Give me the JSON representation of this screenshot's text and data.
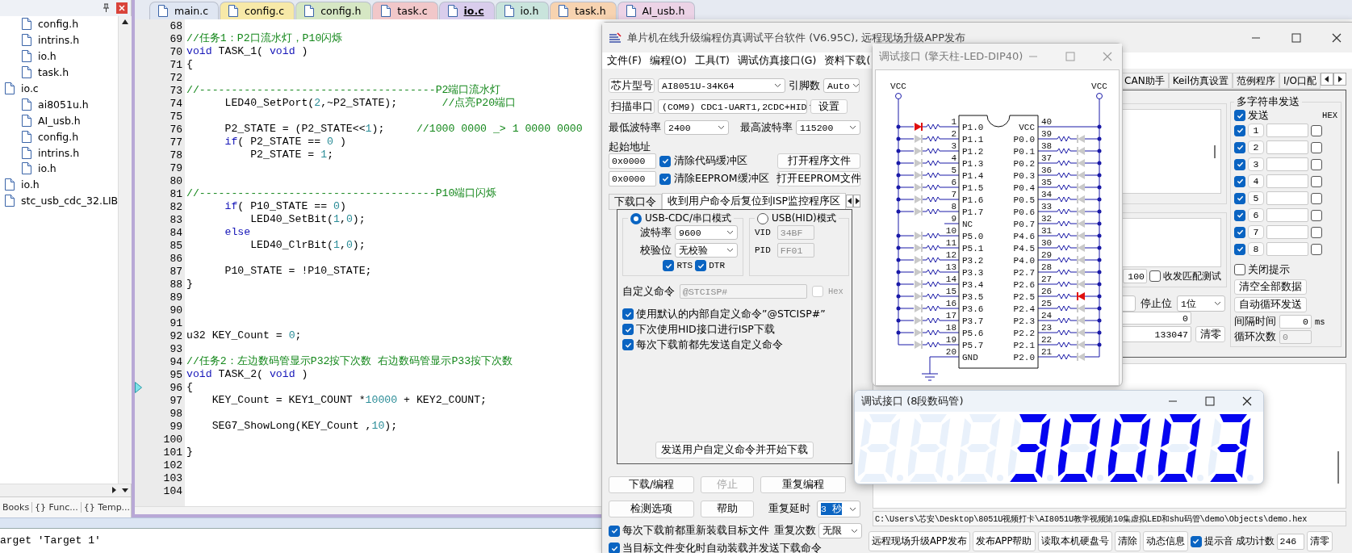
{
  "ide": {
    "project_panel": {
      "tree": [
        {
          "children": [
            {
              "label": "config.h"
            },
            {
              "label": "intrins.h"
            },
            {
              "label": "io.h"
            },
            {
              "label": "task.h"
            }
          ]
        },
        {
          "label": "io.c",
          "children": [
            {
              "label": "ai8051u.h"
            },
            {
              "label": "AI_usb.h"
            },
            {
              "label": "config.h"
            },
            {
              "label": "intrins.h"
            },
            {
              "label": "io.h"
            }
          ]
        },
        {
          "label": "io.h"
        },
        {
          "label": "stc_usb_cdc_32.LIB"
        }
      ],
      "bottom_tabs": [
        {
          "label": "Books"
        },
        {
          "label": "{} Func..."
        },
        {
          "label": "{} Temp..."
        }
      ]
    },
    "editor": {
      "tabs": [
        {
          "label": "main.c",
          "selected": false,
          "color": "#dfe6f2"
        },
        {
          "label": "config.c",
          "selected": false,
          "color": "#f7e9a8"
        },
        {
          "label": "config.h",
          "selected": false,
          "color": "#d6e7c4"
        },
        {
          "label": "task.c",
          "selected": false,
          "color": "#f1c7c9"
        },
        {
          "label": "io.c",
          "selected": true,
          "color": "#d9cdec"
        },
        {
          "label": "io.h",
          "selected": false,
          "color": "#c9e4dc"
        },
        {
          "label": "task.h",
          "selected": false,
          "color": "#f7d3b0"
        },
        {
          "label": "AI_usb.h",
          "selected": false,
          "color": "#ecd3e6"
        }
      ],
      "lines": [
        {
          "number": "68",
          "current": false
        },
        {
          "number": "69",
          "current": false,
          "segments": [
            {
              "kind": "comment",
              "text": "//任务1：P2口流水灯，P10闪烁"
            }
          ]
        },
        {
          "number": "70",
          "current": false,
          "segments": [
            {
              "kind": "keyword",
              "text": "void"
            },
            {
              "kind": "plain",
              "text": " TASK_1( "
            },
            {
              "kind": "keyword",
              "text": "void"
            },
            {
              "kind": "plain",
              "text": " )"
            }
          ]
        },
        {
          "number": "71",
          "current": false,
          "segments": [
            {
              "kind": "plain",
              "text": "{"
            }
          ]
        },
        {
          "number": "72",
          "current": false
        },
        {
          "number": "73",
          "current": false,
          "segments": [
            {
              "kind": "comment",
              "text": "//-------------------------------------P2端口流水灯"
            }
          ]
        },
        {
          "number": "74",
          "current": false,
          "segments": [
            {
              "kind": "plain",
              "text": "      LED40_SetPort("
            },
            {
              "kind": "number",
              "text": "2"
            },
            {
              "kind": "plain",
              "text": ",~P2_STATE);       "
            },
            {
              "kind": "comment",
              "text": "//点亮P20端口"
            }
          ]
        },
        {
          "number": "75",
          "current": false
        },
        {
          "number": "76",
          "current": false,
          "segments": [
            {
              "kind": "plain",
              "text": "      P2_STATE = (P2_STATE<<"
            },
            {
              "kind": "number",
              "text": "1"
            },
            {
              "kind": "plain",
              "text": ");     "
            },
            {
              "kind": "comment",
              "text": "//1000 0000 _> 1 0000 0000"
            }
          ]
        },
        {
          "number": "77",
          "current": false,
          "segments": [
            {
              "kind": "keyword",
              "text": "      if"
            },
            {
              "kind": "plain",
              "text": "( P2_STATE == "
            },
            {
              "kind": "number",
              "text": "0"
            },
            {
              "kind": "plain",
              "text": " )"
            }
          ]
        },
        {
          "number": "78",
          "current": false,
          "segments": [
            {
              "kind": "plain",
              "text": "          P2_STATE = "
            },
            {
              "kind": "number",
              "text": "1"
            },
            {
              "kind": "plain",
              "text": ";"
            }
          ]
        },
        {
          "number": "79",
          "current": false
        },
        {
          "number": "80",
          "current": false
        },
        {
          "number": "81",
          "current": false,
          "segments": [
            {
              "kind": "comment",
              "text": "//-------------------------------------P10端口闪烁"
            }
          ]
        },
        {
          "number": "82",
          "current": false,
          "segments": [
            {
              "kind": "keyword",
              "text": "      if"
            },
            {
              "kind": "plain",
              "text": "( P10_STATE == "
            },
            {
              "kind": "number",
              "text": "0"
            },
            {
              "kind": "plain",
              "text": ")"
            }
          ]
        },
        {
          "number": "83",
          "current": false,
          "segments": [
            {
              "kind": "plain",
              "text": "          LED40_SetBit("
            },
            {
              "kind": "number",
              "text": "1"
            },
            {
              "kind": "plain",
              "text": ","
            },
            {
              "kind": "number",
              "text": "0"
            },
            {
              "kind": "plain",
              "text": ");"
            }
          ]
        },
        {
          "number": "84",
          "current": false,
          "segments": [
            {
              "kind": "keyword",
              "text": "      else"
            }
          ]
        },
        {
          "number": "85",
          "current": false,
          "segments": [
            {
              "kind": "plain",
              "text": "          LED40_ClrBit("
            },
            {
              "kind": "number",
              "text": "1"
            },
            {
              "kind": "plain",
              "text": ","
            },
            {
              "kind": "number",
              "text": "0"
            },
            {
              "kind": "plain",
              "text": ");"
            }
          ]
        },
        {
          "number": "86",
          "current": false
        },
        {
          "number": "87",
          "current": false,
          "segments": [
            {
              "kind": "plain",
              "text": "      P10_STATE = !P10_STATE;"
            }
          ]
        },
        {
          "number": "88",
          "current": false,
          "segments": [
            {
              "kind": "plain",
              "text": "}"
            }
          ]
        },
        {
          "number": "89",
          "current": false
        },
        {
          "number": "90",
          "current": false
        },
        {
          "number": "91",
          "current": false
        },
        {
          "number": "92",
          "current": false,
          "segments": [
            {
              "kind": "plain",
              "text": "u32 KEY_Count = "
            },
            {
              "kind": "number",
              "text": "0"
            },
            {
              "kind": "plain",
              "text": ";"
            }
          ]
        },
        {
          "number": "93",
          "current": false
        },
        {
          "number": "94",
          "current": false,
          "segments": [
            {
              "kind": "comment",
              "text": "//任务2：左边数码管显示P32按下次数 右边数码管显示P33按下次数"
            }
          ]
        },
        {
          "number": "95",
          "current": false,
          "segments": [
            {
              "kind": "keyword",
              "text": "void"
            },
            {
              "kind": "plain",
              "text": " TASK_2( "
            },
            {
              "kind": "keyword",
              "text": "void"
            },
            {
              "kind": "plain",
              "text": " )"
            }
          ]
        },
        {
          "number": "96",
          "current": true,
          "segments": [
            {
              "kind": "plain",
              "text": "{"
            }
          ]
        },
        {
          "number": "97",
          "current": false,
          "segments": [
            {
              "kind": "plain",
              "text": "    KEY_Count = KEY1_COUNT *"
            },
            {
              "kind": "number",
              "text": "10000"
            },
            {
              "kind": "plain",
              "text": " + KEY2_COUNT;"
            }
          ]
        },
        {
          "number": "98",
          "current": false
        },
        {
          "number": "99",
          "current": false,
          "segments": [
            {
              "kind": "plain",
              "text": "    SEG7_ShowLong(KEY_Count ,"
            },
            {
              "kind": "number",
              "text": "10"
            },
            {
              "kind": "plain",
              "text": ");"
            }
          ]
        },
        {
          "number": "100",
          "current": false
        },
        {
          "number": "101",
          "current": false,
          "segments": [
            {
              "kind": "plain",
              "text": "}"
            }
          ]
        },
        {
          "number": "102",
          "current": false
        },
        {
          "number": "103",
          "current": false
        },
        {
          "number": "104",
          "current": false
        }
      ]
    },
    "output": {
      "text": "arget 'Target 1'"
    }
  },
  "isp": {
    "title": "单片机在线升级编程仿真调试平台软件 (V6.95C), 远程现场升级APP发布",
    "menu": [
      "文件(F)",
      "编程(O)",
      "工具(T)",
      "调试仿真接口(G)",
      "资料下载("
    ],
    "chip": {
      "button": "芯片型号",
      "value": "AI8051U-34K64",
      "pins_label": "引脚数",
      "pins_value": "Auto"
    },
    "port": {
      "button": "扫描串口",
      "value": "(COM9) CDC1-UART1,2CDC+HID",
      "settings_button": "设置"
    },
    "baud": {
      "min_label": "最低波特率",
      "min_value": "2400",
      "max_label": "最高波特率",
      "max_value": "115200"
    },
    "start_address": {
      "label": "起始地址",
      "rows": [
        {
          "value": "0x0000",
          "checkbox": "清除代码缓冲区",
          "checked": true,
          "button": "打开程序文件"
        },
        {
          "value": "0x0000",
          "checkbox": "清除EEPROM缓冲区",
          "checked": true,
          "button": "打开EEPROM文件"
        }
      ]
    },
    "tabs": [
      {
        "label": "下载口令",
        "selected": false
      },
      {
        "label": "收到用户命令后复位到ISP监控程序区",
        "selected": true
      }
    ],
    "cdc_group": {
      "label": "USB-CDC/串口模式",
      "selected": true,
      "baud_label": "波特率",
      "baud_value": "9600",
      "parity_label": "校验位",
      "parity_value": "无校验",
      "flags": [
        {
          "label": "RTS",
          "checked": true
        },
        {
          "label": "DTR",
          "checked": true
        }
      ]
    },
    "hid_group": {
      "label": "USB(HID)模式",
      "selected": false,
      "vid_label": "VID",
      "vid_value": "34BF",
      "pid_label": "PID",
      "pid_value": "FF01"
    },
    "custom_command": {
      "label": "自定义命令",
      "value": "@STCISP#",
      "hex_label": "Hex",
      "hex_checked": false
    },
    "options": [
      {
        "label": "使用默认的内部自定义命令”@STCISP#”",
        "checked": true
      },
      {
        "label": "下次使用HID接口进行ISP下载",
        "checked": true
      },
      {
        "label": "每次下载前都先发送自定义命令",
        "checked": true
      }
    ],
    "send_button": "发送用户自定义命令并开始下载",
    "action_buttons": [
      {
        "label": "下载/编程",
        "disabled": false
      },
      {
        "label": "停止",
        "disabled": true
      },
      {
        "label": "重复编程",
        "disabled": false
      }
    ],
    "tool_buttons": [
      {
        "label": "检测选项",
        "disabled": false
      },
      {
        "label": "帮助",
        "disabled": false
      }
    ],
    "repeat_delay": {
      "label": "重复延时",
      "value": "3 秒",
      "focused": true
    },
    "repeat_count": {
      "label": "重复次数",
      "value": "无限"
    },
    "bottom_options": [
      {
        "label": "每次下载前都重新装载目标文件",
        "checked": true
      },
      {
        "label": "当目标文件变化时自动装载并发送下载命令",
        "checked": true
      }
    ],
    "right_tabs": [
      {
        "label": "CAN助手",
        "selected": false
      },
      {
        "label": "Keil仿真设置",
        "selected": false
      },
      {
        "label": "范例程序",
        "selected": false
      },
      {
        "label": "I/O口配",
        "selected": false
      }
    ],
    "serial": {
      "match_value": "100",
      "match_label": "收发匹配测试",
      "match_checked": false,
      "stop_label": "停止位",
      "stop_value": "1位",
      "rx_count": "0",
      "tx_count": "133047",
      "clear_button": "清零"
    },
    "multi_send": {
      "title": "多字符串发送",
      "send_label": "发送",
      "send_checked": true,
      "hex_label": "HEX",
      "rows": [
        {
          "label": "1",
          "checked": true,
          "hex": false
        },
        {
          "label": "2",
          "checked": true,
          "hex": false
        },
        {
          "label": "3",
          "checked": true,
          "hex": false
        },
        {
          "label": "4",
          "checked": true,
          "hex": false
        },
        {
          "label": "5",
          "checked": true,
          "hex": false
        },
        {
          "label": "6",
          "checked": true,
          "hex": false
        },
        {
          "label": "7",
          "checked": true,
          "hex": false
        },
        {
          "label": "8",
          "checked": true,
          "hex": false
        }
      ],
      "close_hint": {
        "label": "关闭提示",
        "checked": false
      },
      "clear_all_button": "清空全部数据",
      "auto_loop_button": "自动循环发送",
      "interval_label": "间隔时间",
      "interval_value": "0",
      "interval_unit": "ms",
      "loop_label": "循环次数",
      "loop_value": "0"
    },
    "path": "C:\\Users\\芯安\\Desktop\\8051U视频打卡\\AI8051U教学视频第10集虚拟LED和shu码管\\demo\\Objects\\demo.hex",
    "bottom_buttons": [
      "远程现场升级APP发布",
      "发布APP帮助",
      "读取本机硬盘号",
      "清除",
      "动态信息"
    ],
    "beep": {
      "label": "提示音",
      "checked": true
    },
    "success": {
      "label": "成功计数",
      "value": "246",
      "button": "清零"
    }
  },
  "led_window": {
    "title": "调试接口 (擎天柱-LED-DIP40)",
    "vcc_labels": [
      "VCC",
      "VCC"
    ],
    "left_pins": [
      {
        "number": "1",
        "label": "P1.0",
        "kind": "led",
        "lit": true
      },
      {
        "number": "2",
        "label": "P1.1",
        "kind": "led",
        "lit": false
      },
      {
        "number": "3",
        "label": "P1.2",
        "kind": "led",
        "lit": false
      },
      {
        "number": "4",
        "label": "P1.3",
        "kind": "led",
        "lit": false
      },
      {
        "number": "5",
        "label": "P1.4",
        "kind": "led",
        "lit": false
      },
      {
        "number": "6",
        "label": "P1.5",
        "kind": "led",
        "lit": false
      },
      {
        "number": "7",
        "label": "P1.6",
        "kind": "led",
        "lit": false
      },
      {
        "number": "8",
        "label": "P1.7",
        "kind": "led",
        "lit": false
      },
      {
        "number": "9",
        "label": "NC",
        "kind": "nc"
      },
      {
        "number": "10",
        "label": "P5.0",
        "kind": "led",
        "lit": false
      },
      {
        "number": "11",
        "label": "P5.1",
        "kind": "led",
        "lit": false
      },
      {
        "number": "12",
        "label": "P3.2",
        "kind": "led",
        "lit": false
      },
      {
        "number": "13",
        "label": "P3.3",
        "kind": "led",
        "lit": false
      },
      {
        "number": "14",
        "label": "P3.4",
        "kind": "led",
        "lit": false
      },
      {
        "number": "15",
        "label": "P3.5",
        "kind": "led",
        "lit": false
      },
      {
        "number": "16",
        "label": "P3.6",
        "kind": "led",
        "lit": false
      },
      {
        "number": "17",
        "label": "P3.7",
        "kind": "led",
        "lit": false
      },
      {
        "number": "18",
        "label": "P5.6",
        "kind": "led",
        "lit": false
      },
      {
        "number": "19",
        "label": "P5.7",
        "kind": "led",
        "lit": false
      },
      {
        "number": "20",
        "label": "GND",
        "kind": "gnd"
      }
    ],
    "right_pins": [
      {
        "number": "40",
        "label": "VCC",
        "kind": "vcc"
      },
      {
        "number": "39",
        "label": "P0.0",
        "kind": "led",
        "lit": false
      },
      {
        "number": "38",
        "label": "P0.1",
        "kind": "led",
        "lit": false
      },
      {
        "number": "37",
        "label": "P0.2",
        "kind": "led",
        "lit": false
      },
      {
        "number": "36",
        "label": "P0.3",
        "kind": "led",
        "lit": false
      },
      {
        "number": "35",
        "label": "P0.4",
        "kind": "led",
        "lit": false
      },
      {
        "number": "34",
        "label": "P0.5",
        "kind": "led",
        "lit": false
      },
      {
        "number": "33",
        "label": "P0.6",
        "kind": "led",
        "lit": false
      },
      {
        "number": "32",
        "label": "P0.7",
        "kind": "led",
        "lit": false
      },
      {
        "number": "31",
        "label": "P4.6",
        "kind": "led",
        "lit": false
      },
      {
        "number": "30",
        "label": "P4.5",
        "kind": "led",
        "lit": false
      },
      {
        "number": "29",
        "label": "P4.0",
        "kind": "led",
        "lit": false
      },
      {
        "number": "28",
        "label": "P2.7",
        "kind": "led",
        "lit": false
      },
      {
        "number": "27",
        "label": "P2.6",
        "kind": "led",
        "lit": false
      },
      {
        "number": "26",
        "label": "P2.5",
        "kind": "led",
        "lit": true
      },
      {
        "number": "25",
        "label": "P2.4",
        "kind": "led",
        "lit": false
      },
      {
        "number": "24",
        "label": "P2.3",
        "kind": "led",
        "lit": false
      },
      {
        "number": "23",
        "label": "P2.2",
        "kind": "led",
        "lit": false
      },
      {
        "number": "22",
        "label": "P2.1",
        "kind": "led",
        "lit": false
      },
      {
        "number": "21",
        "label": "P2.0",
        "kind": "led",
        "lit": false
      }
    ]
  },
  "seg_window": {
    "title": "调试接口 (8段数码管)",
    "digits": [
      {
        "a": false,
        "b": false,
        "c": false,
        "d": false,
        "e": false,
        "f": false,
        "g": false
      },
      {
        "a": false,
        "b": false,
        "c": false,
        "d": false,
        "e": false,
        "f": false,
        "g": false
      },
      {
        "a": false,
        "b": false,
        "c": false,
        "d": false,
        "e": false,
        "f": false,
        "g": false
      },
      {
        "a": true,
        "b": true,
        "c": true,
        "d": true,
        "e": false,
        "f": false,
        "g": true
      },
      {
        "a": true,
        "b": true,
        "c": true,
        "d": true,
        "e": true,
        "f": true,
        "g": false
      },
      {
        "a": true,
        "b": true,
        "c": true,
        "d": true,
        "e": true,
        "f": true,
        "g": false
      },
      {
        "a": true,
        "b": true,
        "c": true,
        "d": true,
        "e": true,
        "f": true,
        "g": false
      },
      {
        "a": true,
        "b": true,
        "c": true,
        "d": true,
        "e": false,
        "f": false,
        "g": true
      }
    ]
  }
}
